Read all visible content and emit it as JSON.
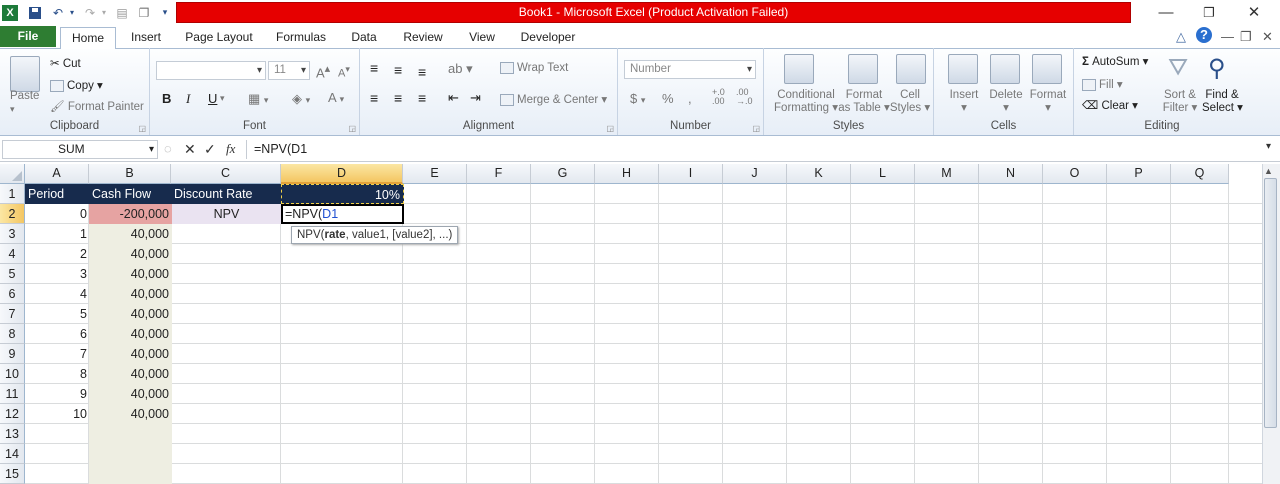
{
  "window": {
    "title": "Book1  -  Microsoft Excel (Product Activation Failed)",
    "title_bar_color": "#e60000"
  },
  "quick_access": {
    "icons": [
      "excel-logo-icon",
      "save-icon",
      "undo-icon",
      "redo-icon",
      "print-preview-icon",
      "copy-icon",
      "customize-icon"
    ]
  },
  "tabs": {
    "file": "File",
    "items": [
      "Home",
      "Insert",
      "Page Layout",
      "Formulas",
      "Data",
      "Review",
      "View",
      "Developer"
    ]
  },
  "ribbon": {
    "clipboard": {
      "label": "Clipboard",
      "paste": "Paste",
      "cut": "Cut",
      "copy": "Copy",
      "format_painter": "Format Painter"
    },
    "font": {
      "label": "Font",
      "size": "11",
      "bold": "B",
      "italic": "I",
      "underline": "U"
    },
    "alignment": {
      "label": "Alignment",
      "wrap_text": "Wrap Text",
      "merge_center": "Merge & Center"
    },
    "number": {
      "label": "Number",
      "format": "Number",
      "currency": "$",
      "percent": "%"
    },
    "styles": {
      "label": "Styles",
      "conditional_1": "Conditional",
      "conditional_2": "Formatting",
      "format_table_1": "Format",
      "format_table_2": "as Table",
      "cell_styles_1": "Cell",
      "cell_styles_2": "Styles"
    },
    "cells": {
      "label": "Cells",
      "insert": "Insert",
      "delete": "Delete",
      "format": "Format"
    },
    "editing": {
      "label": "Editing",
      "autosum": "AutoSum",
      "fill": "Fill",
      "clear": "Clear",
      "sort_1": "Sort &",
      "sort_2": "Filter",
      "find_1": "Find &",
      "find_2": "Select"
    }
  },
  "formula_bar": {
    "name_box": "SUM",
    "fx": "fx",
    "formula": "=NPV(D1"
  },
  "grid": {
    "columns": [
      "A",
      "B",
      "C",
      "D",
      "E",
      "F",
      "G",
      "H",
      "I",
      "J",
      "K",
      "L",
      "M",
      "N",
      "O",
      "P",
      "Q"
    ],
    "rows": [
      "1",
      "2",
      "3",
      "4",
      "5",
      "6",
      "7",
      "8",
      "9",
      "10",
      "11",
      "12",
      "13",
      "14",
      "15"
    ],
    "header_row": {
      "a": "Period",
      "b": "Cash Flow",
      "c": "Discount Rate",
      "d": "10%"
    },
    "npv_label": "NPV",
    "editing_cell": {
      "prefix": "=NPV(",
      "ref": "D1"
    },
    "periods": [
      "0",
      "1",
      "2",
      "3",
      "4",
      "5",
      "6",
      "7",
      "8",
      "9",
      "10"
    ],
    "cash_flows": [
      "-200,000",
      "40,000",
      "40,000",
      "40,000",
      "40,000",
      "40,000",
      "40,000",
      "40,000",
      "40,000",
      "40,000",
      "40,000"
    ],
    "colors": {
      "header_bg": "#172b4d",
      "negative_bg": "#e6a3a2",
      "cashflow_bg": "#eeeee2",
      "npv_bg": "#eae3f1"
    }
  },
  "tooltip": {
    "fn": "NPV(",
    "arg_bold": "rate",
    "rest": ", value1, [value2], ...)"
  }
}
